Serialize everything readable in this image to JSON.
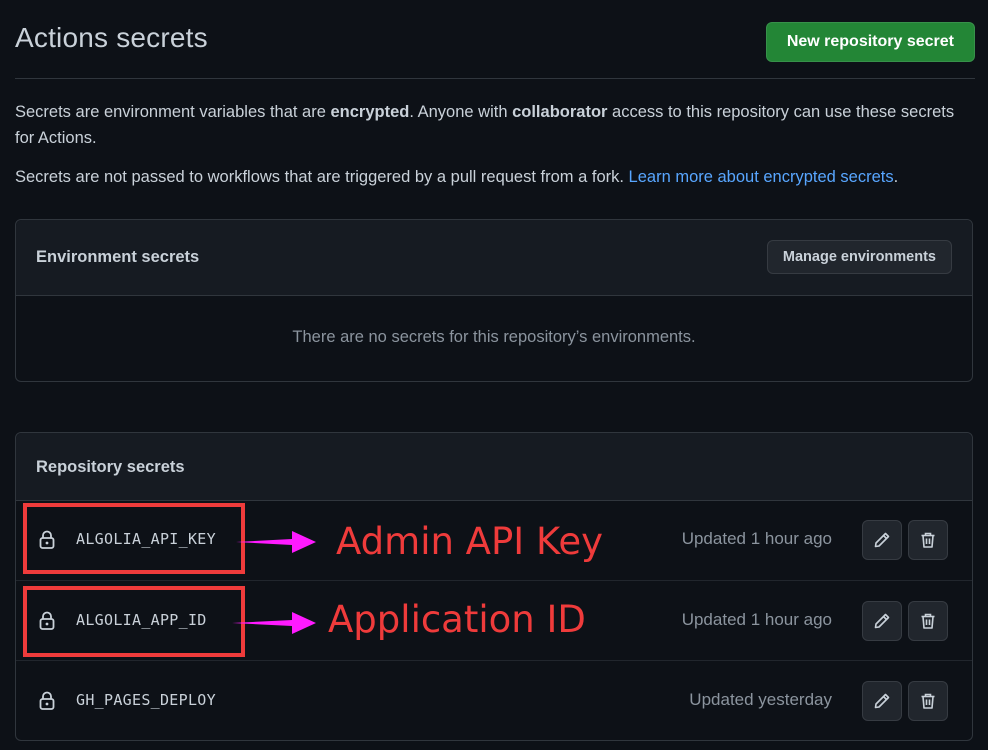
{
  "header": {
    "title": "Actions secrets",
    "new_secret_button": "New repository secret"
  },
  "description": {
    "p1_part1": "Secrets are environment variables that are ",
    "p1_bold1": "encrypted",
    "p1_part2": ". Anyone with ",
    "p1_bold2": "collaborator",
    "p1_part3": " access to this repository can use these secrets for Actions.",
    "p2_text": "Secrets are not passed to workflows that are triggered by a pull request from a fork. ",
    "p2_link": "Learn more about encrypted secrets",
    "p2_end": "."
  },
  "environment_secrets": {
    "title": "Environment secrets",
    "manage_button": "Manage environments",
    "empty_message": "There are no secrets for this repository’s environments."
  },
  "repository_secrets": {
    "title": "Repository secrets",
    "items": [
      {
        "name": "ALGOLIA_API_KEY",
        "updated": "Updated 1 hour ago"
      },
      {
        "name": "ALGOLIA_APP_ID",
        "updated": "Updated 1 hour ago"
      },
      {
        "name": "GH_PAGES_DEPLOY",
        "updated": "Updated yesterday"
      }
    ]
  },
  "annotations": {
    "label1": "Admin API Key",
    "label2": "Application ID",
    "color": "#ef3b3b",
    "arrow_color": "#ff1aff"
  },
  "colors": {
    "background": "#0d1117",
    "primary_button": "#238636",
    "link": "#58a6ff",
    "border": "#30363d"
  },
  "icons": {
    "lock": "lock-icon",
    "edit": "pencil-icon",
    "delete": "trash-icon"
  }
}
